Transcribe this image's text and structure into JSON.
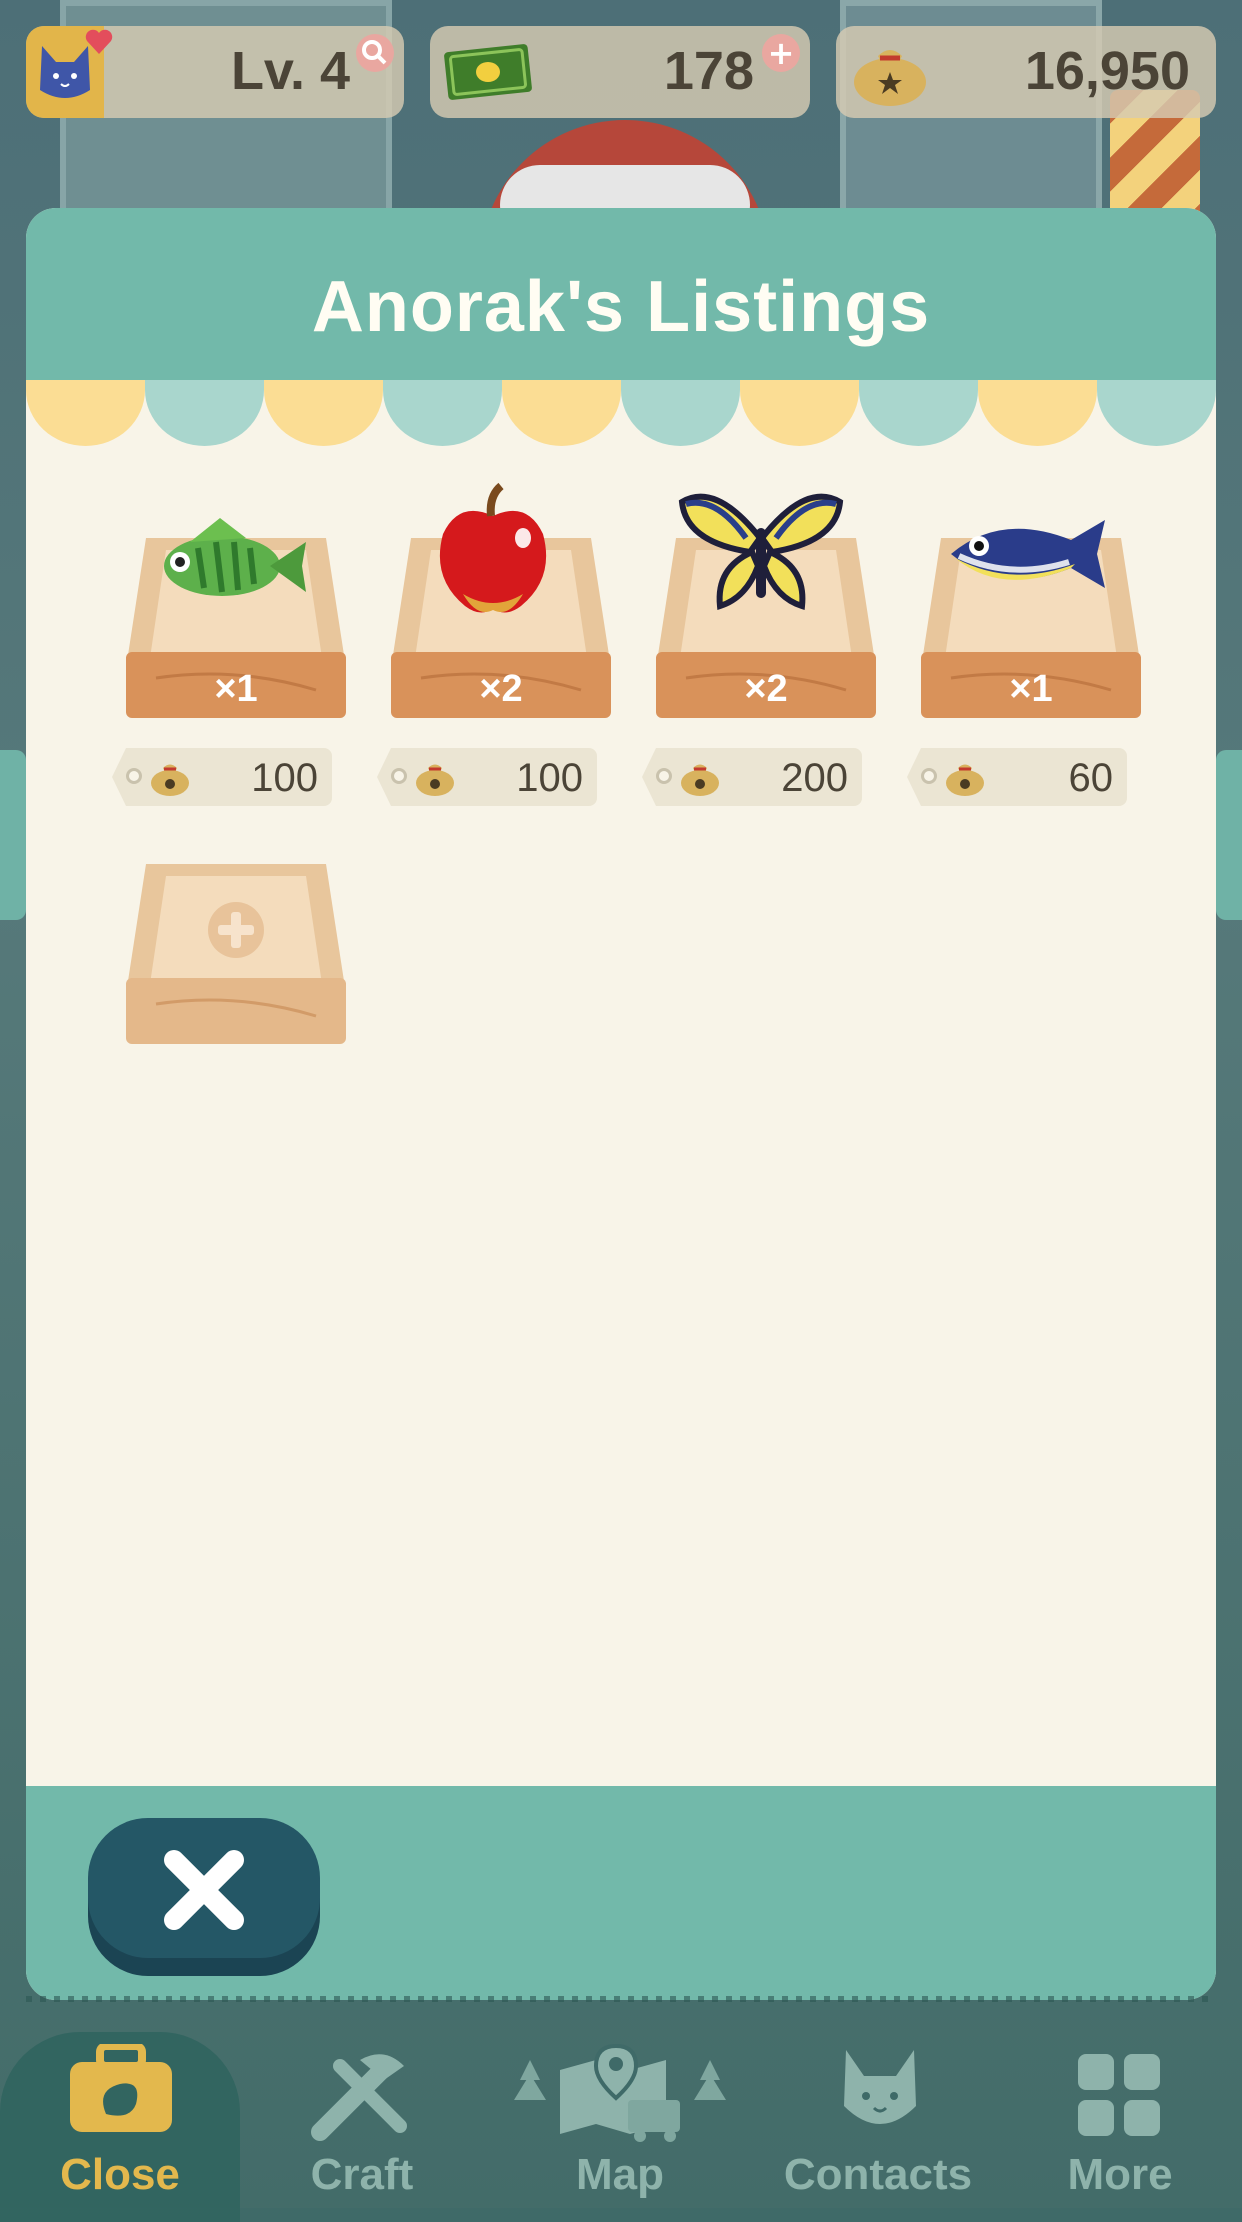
{
  "hud": {
    "level_text": "Lv. 4",
    "tickets": "178",
    "bells": "16,950"
  },
  "modal": {
    "title": "Anorak's Listings",
    "listings": [
      {
        "item": "fish",
        "quantity": "×1",
        "price": "100"
      },
      {
        "item": "apple",
        "quantity": "×2",
        "price": "100"
      },
      {
        "item": "butterfly",
        "quantity": "×2",
        "price": "200"
      },
      {
        "item": "fish",
        "quantity": "×1",
        "price": "60"
      }
    ],
    "empty_slot_icon": "plus-icon",
    "close_icon": "close-x-icon"
  },
  "nav": {
    "items": [
      {
        "label": "Close",
        "icon": "bag-icon",
        "active": true
      },
      {
        "label": "Craft",
        "icon": "craft-tools-icon"
      },
      {
        "label": "Map",
        "icon": "map-icon"
      },
      {
        "label": "Contacts",
        "icon": "cat-contacts-icon"
      },
      {
        "label": "More",
        "icon": "grid-icon"
      }
    ]
  },
  "colors": {
    "accent_teal": "#72b9aa",
    "dark_teal": "#245766",
    "cream": "#f8f4e8",
    "wood": "#d9925a",
    "awning_yellow": "#fbdd94",
    "awning_teal": "#a9d6cd"
  }
}
